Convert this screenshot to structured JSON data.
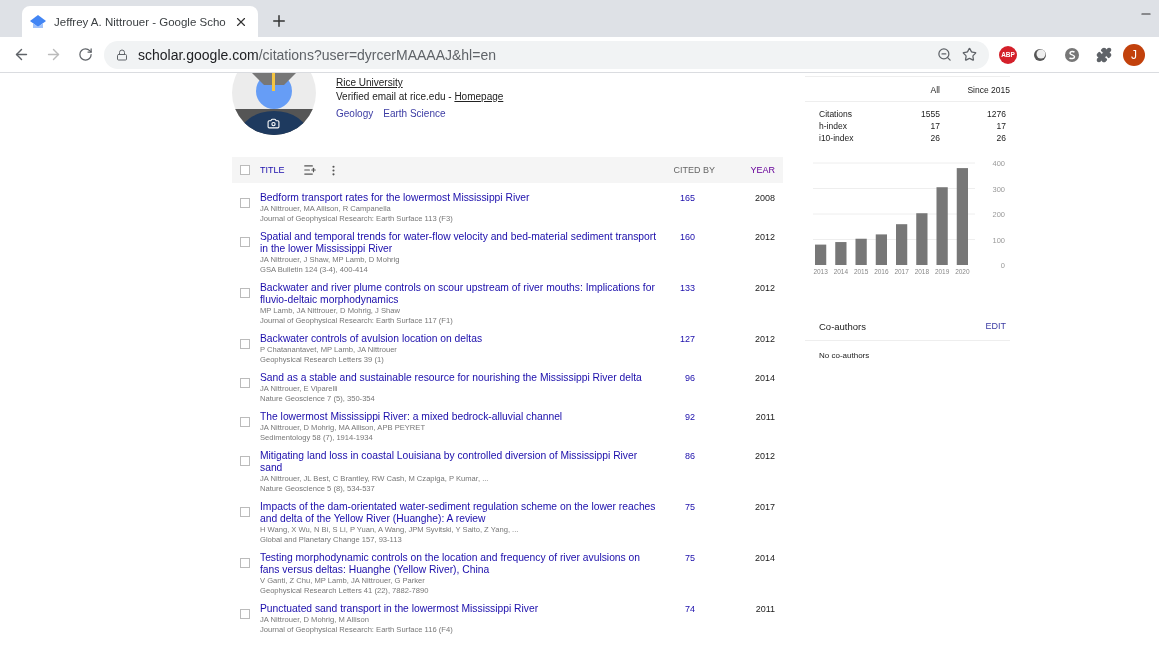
{
  "browser": {
    "tab": {
      "title": "Jeffrey A. Nittrouer - Google Scho",
      "selected": true
    },
    "url_host": "scholar.google.com",
    "url_path": "/citations?user=dyrcerMAAAAJ&hl=en",
    "abp_label": "ABP",
    "profile_initial": "J"
  },
  "profile": {
    "affiliation": "Rice University",
    "email_text": "Verified email at rice.edu - ",
    "homepage": "Homepage",
    "interests": [
      "Geology",
      "Earth Science"
    ]
  },
  "table": {
    "select_all": {
      "checked": false
    },
    "title_header": "TITLE",
    "cited_header": "CITED BY",
    "year_header": "YEAR",
    "rows": [
      {
        "title": "Bedform transport rates for the lowermost Mississippi River",
        "authors": "JA Nittrouer, MA Allison, R Campanella",
        "venue": "Journal of Geophysical Research: Earth Surface 113 (F3)",
        "cited_by": "165",
        "year": "2008",
        "checked": false
      },
      {
        "title": "Spatial and temporal trends for water-flow velocity and bed-material sediment transport in the lower Mississippi River",
        "authors": "JA Nittrouer, J Shaw, MP Lamb, D Mohrig",
        "venue": "GSA Bulletin 124 (3-4), 400-414",
        "cited_by": "160",
        "year": "2012",
        "checked": false
      },
      {
        "title": "Backwater and river plume controls on scour upstream of river mouths: Implications for fluvio-deltaic morphodynamics",
        "authors": "MP Lamb, JA Nittrouer, D Mohrig, J Shaw",
        "venue": "Journal of Geophysical Research: Earth Surface 117 (F1)",
        "cited_by": "133",
        "year": "2012",
        "checked": false
      },
      {
        "title": "Backwater controls of avulsion location on deltas",
        "authors": "P Chatanantavet, MP Lamb, JA Nittrouer",
        "venue": "Geophysical Research Letters 39 (1)",
        "cited_by": "127",
        "year": "2012",
        "checked": false
      },
      {
        "title": "Sand as a stable and sustainable resource for nourishing the Mississippi River delta",
        "authors": "JA Nittrouer, E Viparelli",
        "venue": "Nature Geoscience 7 (5), 350-354",
        "cited_by": "96",
        "year": "2014",
        "checked": false
      },
      {
        "title": "The lowermost Mississippi River: a mixed bedrock-alluvial channel",
        "authors": "JA Nittrouer, D Mohrig, MA Allison, APB PEYRET",
        "venue": "Sedimentology 58 (7), 1914-1934",
        "cited_by": "92",
        "year": "2011",
        "checked": false
      },
      {
        "title": "Mitigating land loss in coastal Louisiana by controlled diversion of Mississippi River sand",
        "authors": "JA Nittrouer, JL Best, C Brantley, RW Cash, M Czapiga, P Kumar, ...",
        "venue": "Nature Geoscience 5 (8), 534-537",
        "cited_by": "86",
        "year": "2012",
        "checked": false
      },
      {
        "title": "Impacts of the dam-orientated water-sediment regulation scheme on the lower reaches and delta of the Yellow River (Huanghe): A review",
        "authors": "H Wang, X Wu, N Bi, S Li, P Yuan, A Wang, JPM Syvitski, Y Saito, Z Yang, ...",
        "venue": "Global and Planetary Change 157, 93-113",
        "cited_by": "75",
        "year": "2017",
        "checked": false
      },
      {
        "title": "Testing morphodynamic controls on the location and frequency of river avulsions on fans versus deltas: Huanghe (Yellow River), China",
        "authors": "V Ganti, Z Chu, MP Lamb, JA Nittrouer, G Parker",
        "venue": "Geophysical Research Letters 41 (22), 7882-7890",
        "cited_by": "75",
        "year": "2014",
        "checked": false
      },
      {
        "title": "Punctuated sand transport in the lowermost Mississippi River",
        "authors": "JA Nittrouer, D Mohrig, M Allison",
        "venue": "Journal of Geophysical Research: Earth Surface 116 (F4)",
        "cited_by": "74",
        "year": "2011",
        "checked": false
      }
    ]
  },
  "stats": {
    "columns": [
      "All",
      "Since 2015"
    ],
    "rows": [
      {
        "label": "Citations",
        "all": "1555",
        "since": "1276"
      },
      {
        "label": "h-index",
        "all": "17",
        "since": "17"
      },
      {
        "label": "i10-index",
        "all": "26",
        "since": "26"
      }
    ]
  },
  "chart_data": {
    "type": "bar",
    "categories": [
      "2013",
      "2014",
      "2015",
      "2016",
      "2017",
      "2018",
      "2019",
      "2020"
    ],
    "values": [
      80,
      90,
      103,
      120,
      160,
      203,
      305,
      380
    ],
    "ylim": [
      0,
      400
    ],
    "yticks": [
      0,
      100,
      200,
      300,
      400
    ],
    "grid": true
  },
  "coauthors": {
    "title": "Co-authors",
    "edit": "EDIT",
    "empty": "No co-authors"
  }
}
